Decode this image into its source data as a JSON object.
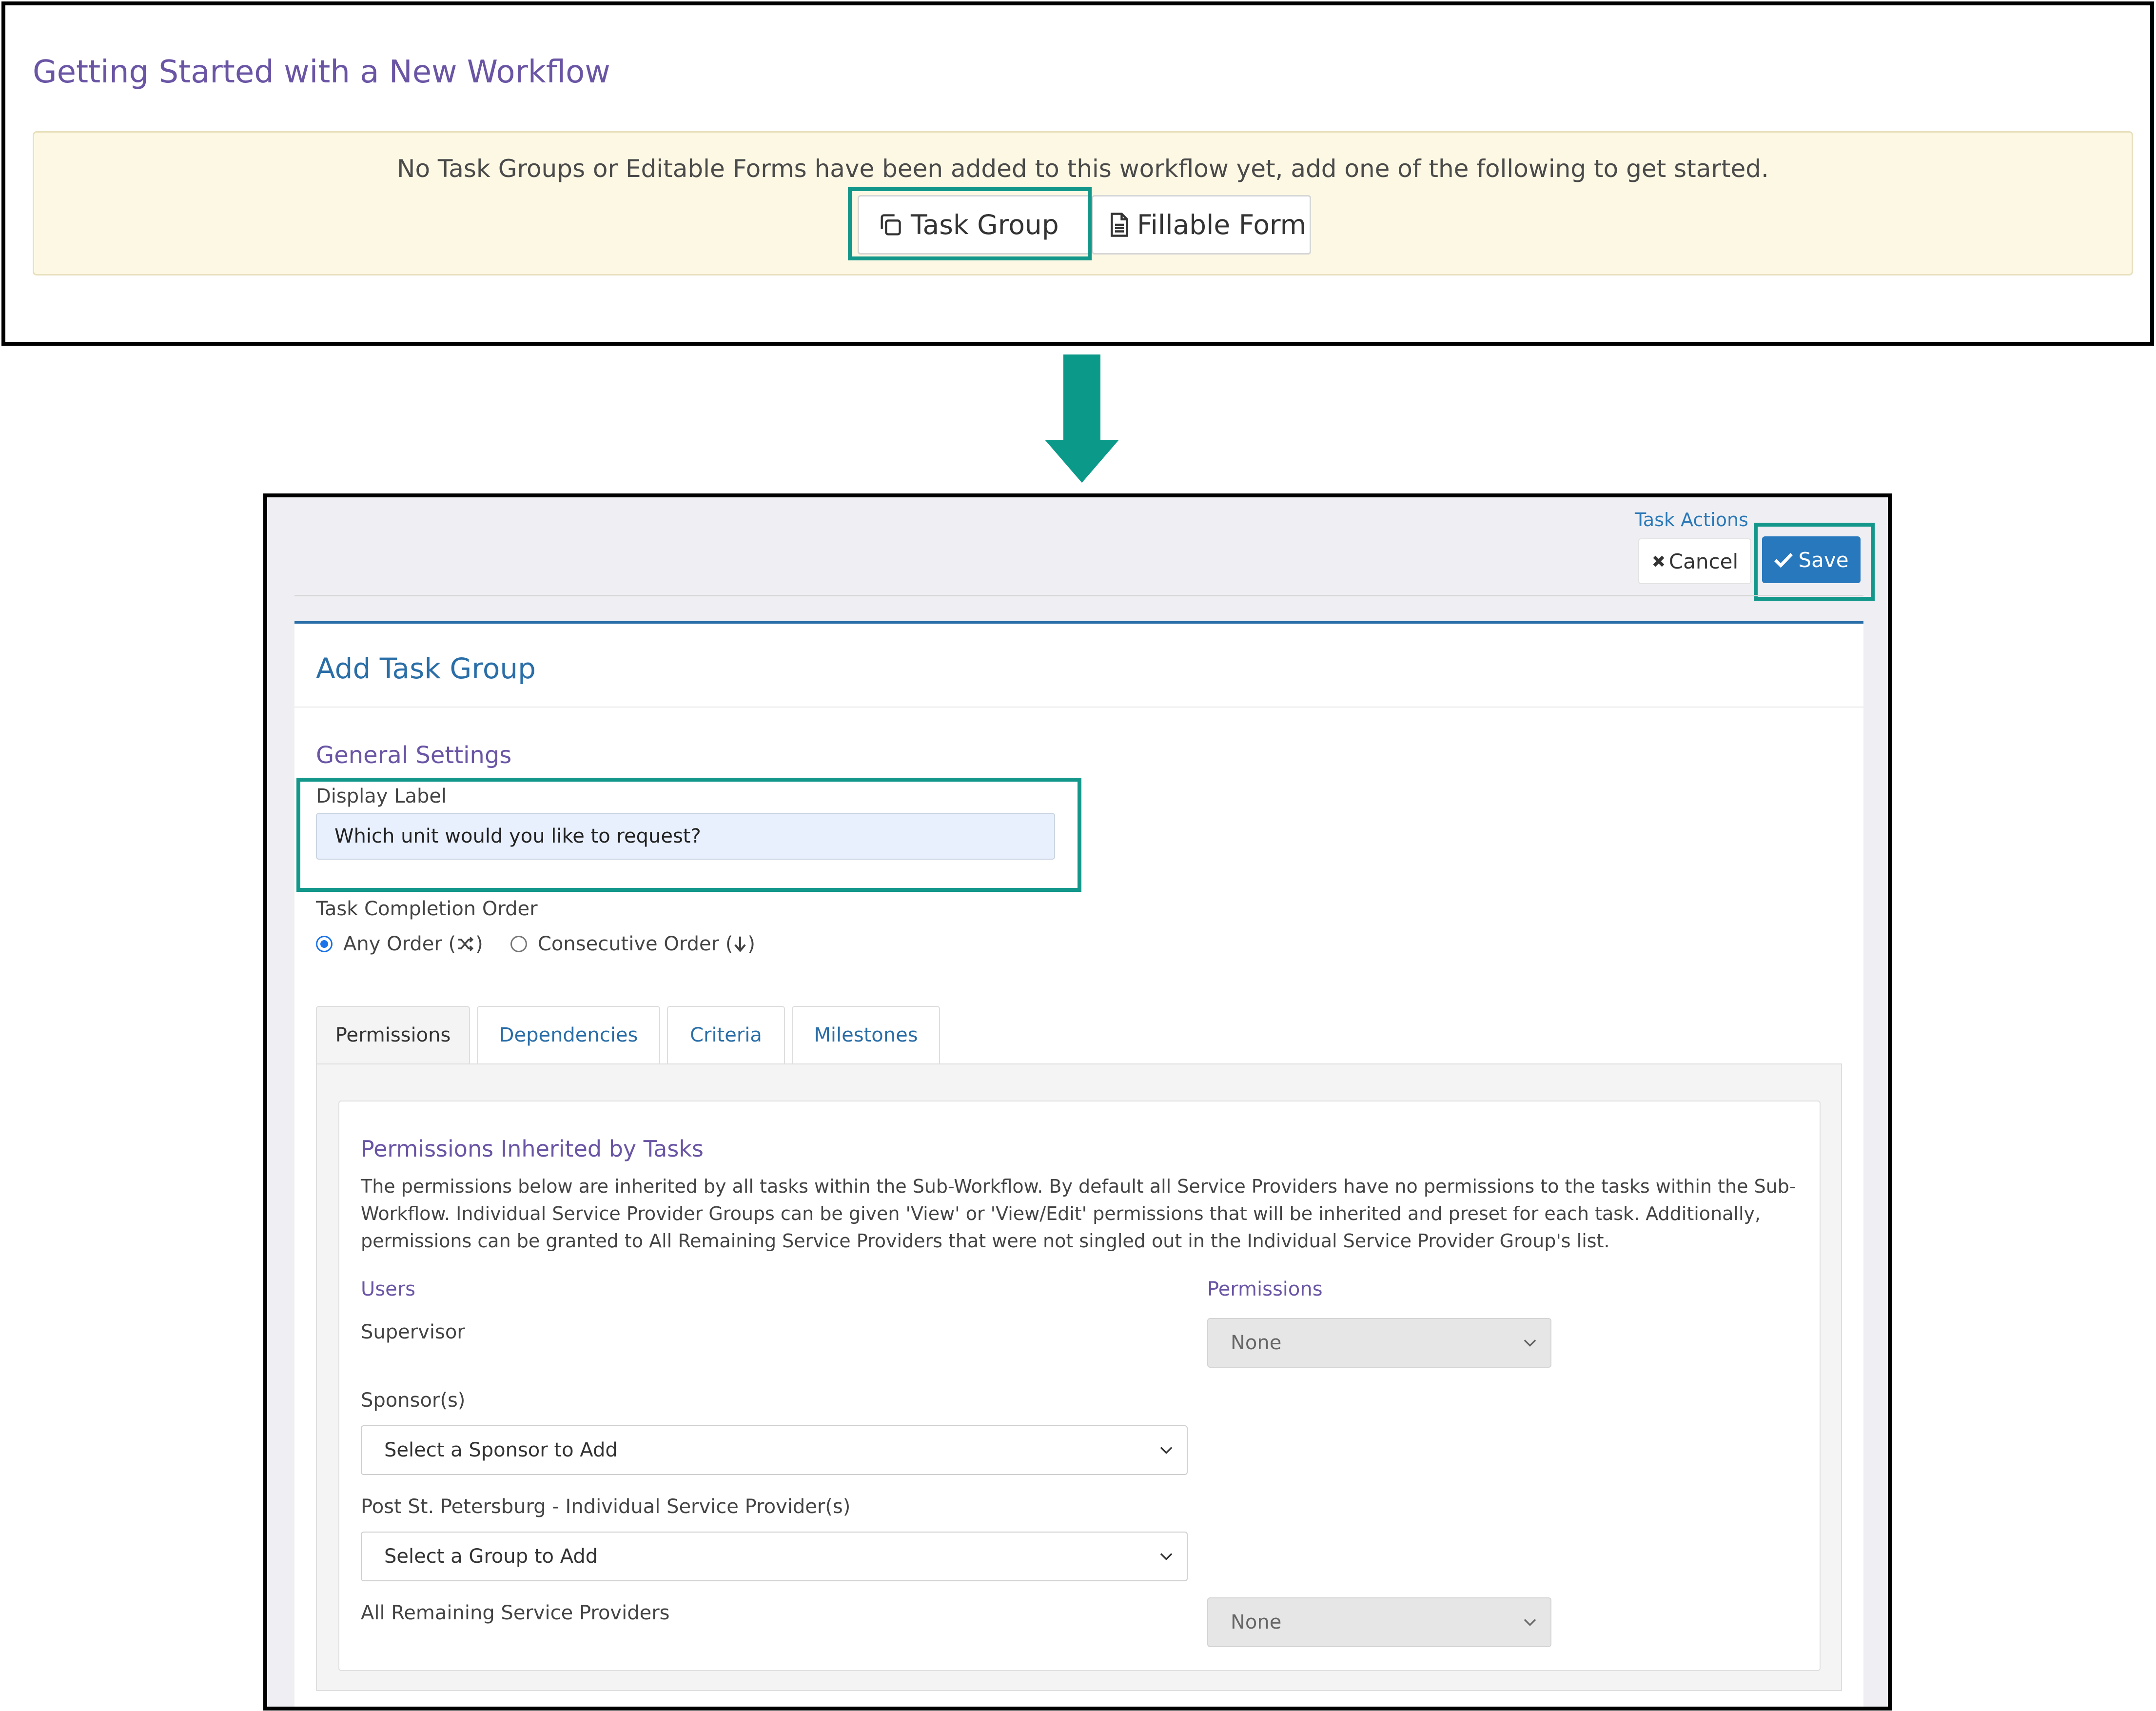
{
  "top_panel": {
    "title": "Getting Started with a New Workflow",
    "notice": "No Task Groups or Editable Forms have been added to this workflow yet, add one of the following to get started.",
    "buttons": [
      {
        "label": "Task Group",
        "icon": "copy-icon"
      },
      {
        "label": "Fillable Form",
        "icon": "file-text-icon"
      }
    ]
  },
  "task_actions": {
    "label": "Task Actions",
    "cancel": "Cancel",
    "save": "Save"
  },
  "card": {
    "title": "Add Task Group",
    "general_settings": "General Settings",
    "display_label": {
      "label": "Display Label",
      "value": "Which unit would you like to request?"
    },
    "task_completion_order": {
      "label": "Task Completion Order",
      "options": [
        {
          "label": "Any Order (",
          "suffix": ")",
          "icon": "shuffle-icon",
          "selected": true
        },
        {
          "label": "Consecutive Order (",
          "suffix": ")",
          "icon": "arrow-down-icon",
          "selected": false
        }
      ]
    }
  },
  "tabs": [
    "Permissions",
    "Dependencies",
    "Criteria",
    "Milestones"
  ],
  "active_tab": "Permissions",
  "permissions": {
    "title": "Permissions Inherited by Tasks",
    "description": "The permissions below are inherited by all tasks within the Sub-Workflow. By default all Service Providers have no permissions to the tasks within the Sub-Workflow. Individual Service Provider Groups can be given 'View' or 'View/Edit' permissions that will be inherited and preset for each task. Additionally, permissions can be granted to All Remaining Service Providers that were not singled out in the Individual Service Provider Group's list.",
    "users_header": "Users",
    "permissions_header": "Permissions",
    "supervisor": {
      "label": "Supervisor",
      "value": "None"
    },
    "sponsors": {
      "label": "Sponsor(s)",
      "placeholder": "Select a Sponsor to Add"
    },
    "individual": {
      "label": "Post St. Petersburg - Individual Service Provider(s)",
      "placeholder": "Select a Group to Add"
    },
    "remaining": {
      "label": "All Remaining Service Providers",
      "value": "None"
    }
  },
  "colors": {
    "highlight": "#12978a",
    "arrow": "#0b9a8a",
    "accent_blue": "#2878be",
    "purple_heading": "#6a55a5",
    "notice_bg": "#fcf8e3"
  }
}
